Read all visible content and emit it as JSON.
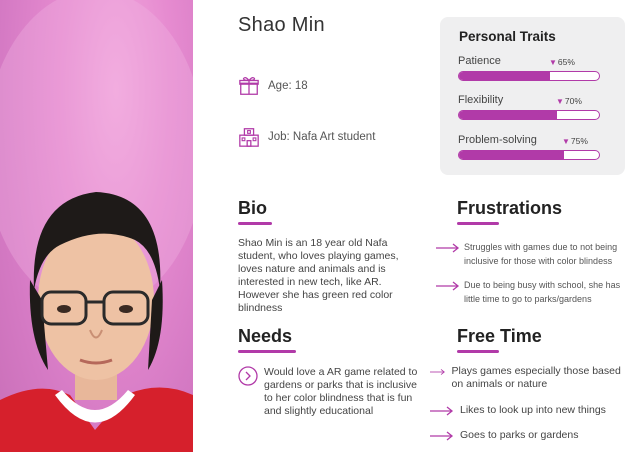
{
  "persona": {
    "name": "Shao Min",
    "age": "Age: 18",
    "job": "Job: Nafa Art student"
  },
  "traits": {
    "title": "Personal Traits",
    "items": [
      {
        "label": "Patience",
        "pct_label": "65%",
        "value": 0.65
      },
      {
        "label": "Flexibility",
        "pct_label": "70%",
        "value": 0.7
      },
      {
        "label": "Problem-solving",
        "pct_label": "75%",
        "value": 0.75
      }
    ]
  },
  "bio": {
    "title": "Bio",
    "text": "Shao Min is an 18 year old Nafa student, who loves playing games, loves nature and animals and is interested in new tech, like AR. However she has green red color blindness"
  },
  "frustrations": {
    "title": "Frustrations",
    "items": [
      "Struggles with games due to not being inclusive for those with color blindess",
      "Due to being busy with school, she has little time to go to parks/gardens"
    ]
  },
  "needs": {
    "title": "Needs",
    "text": "Would love a AR game related to gardens or parks that is inclusive to her color blindness that is fun and slightly educational"
  },
  "free_time": {
    "title": "Free Time",
    "items": [
      "Plays games especially those based on animals or nature",
      "Likes to look up into new things",
      "Goes to parks or gardens"
    ]
  },
  "colors": {
    "accent": "#b13aa8",
    "panel": "#efeff0"
  }
}
